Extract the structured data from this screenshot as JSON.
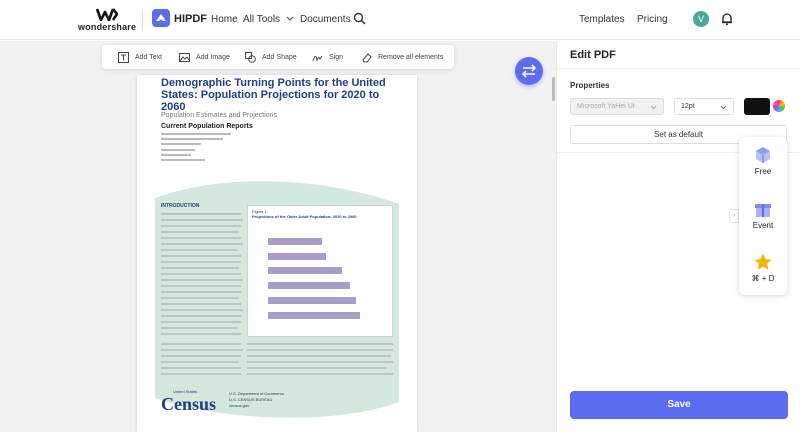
{
  "header": {
    "brand": "wondershare",
    "app_name": "HIPDF",
    "nav": [
      "Home",
      "All Tools",
      "Documents"
    ],
    "right_links": [
      "Templates",
      "Pricing"
    ],
    "avatar_letter": "V"
  },
  "toolbar": {
    "tools": [
      "Add Text",
      "Add Image",
      "Add Shape",
      "Sign",
      "Remove all elements"
    ]
  },
  "document": {
    "title": "Demographic Turning Points for the United States: Population Projections for 2020 to 2060",
    "subtitle": "Population Estimates and Projections",
    "series": "Current Population Reports",
    "intro_heading": "INTRODUCTION",
    "figure_label": "Figure 1.",
    "figure_title": "Projections of the Older Adult Population: 2020 to 2060",
    "census_logo": "Census",
    "census_top": "United States",
    "dept_lines": [
      "U.S. Department of Commerce",
      "U.S. CENSUS BUREAU",
      "census.gov"
    ]
  },
  "panel": {
    "title": "Edit PDF",
    "properties_label": "Properties",
    "font_value": "Microsoft YaHei UI",
    "size_value": "12pt",
    "set_default_label": "Set as default",
    "save_label": "Save",
    "promo": [
      {
        "label": "Free",
        "icon": "gift-cube-icon"
      },
      {
        "label": "Event",
        "icon": "gift-box-icon"
      },
      {
        "label": "⌘ + D",
        "icon": "star-icon"
      }
    ]
  },
  "colors": {
    "accent": "#5b6cf0",
    "green_band": "#d4e8de",
    "title_blue": "#1f3f86",
    "bar_purple": "#a89cc9"
  }
}
